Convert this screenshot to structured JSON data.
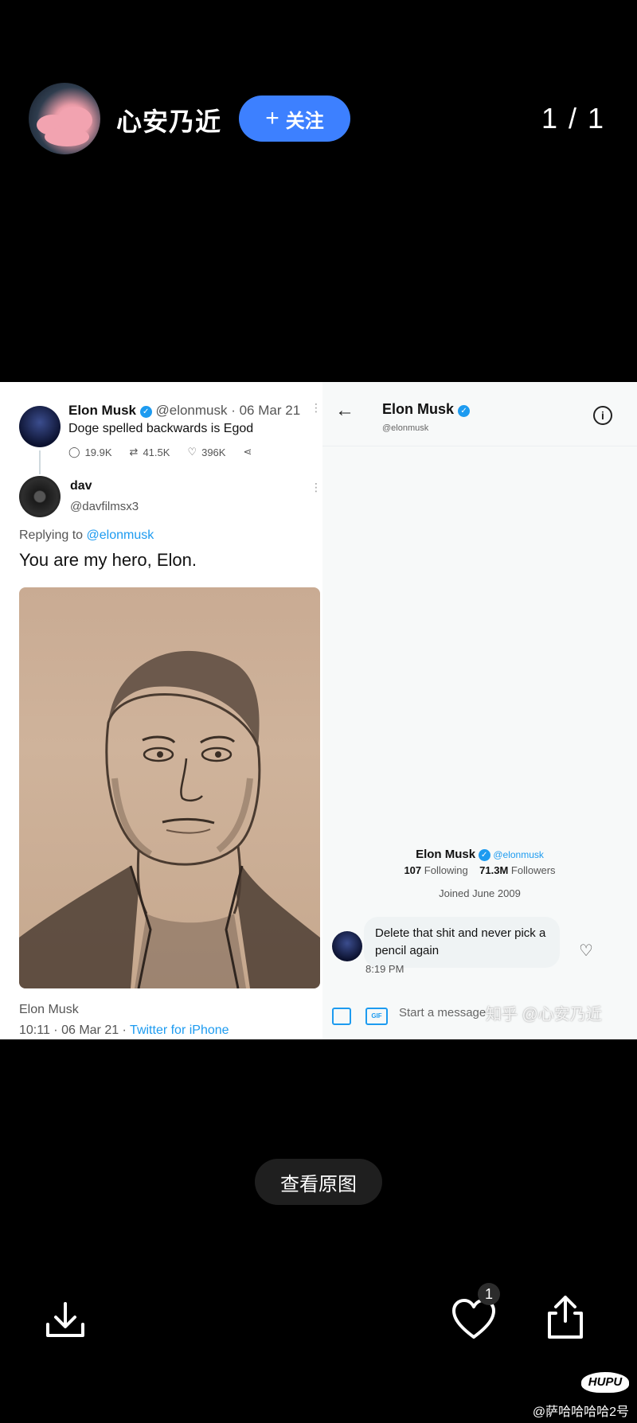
{
  "header": {
    "username": "心安乃近",
    "follow_label": "关注",
    "page_counter": "1 / 1"
  },
  "tweet": {
    "author_name": "Elon Musk",
    "handle_date": "@elonmusk · 06 Mar 21",
    "text": "Doge spelled backwards is Egod",
    "replies": "19.9K",
    "retweets": "41.5K",
    "likes": "396K"
  },
  "reply": {
    "name": "dav",
    "handle": "@davfilmsx3",
    "replying_prefix": "Replying to ",
    "replying_mention": "@elonmusk",
    "text": "You are my hero, Elon.",
    "footer_name": "Elon Musk",
    "footer_time": "10:11 · 06 Mar 21 · ",
    "footer_source": "Twitter for iPhone"
  },
  "dm": {
    "title": "Elon Musk",
    "handle": "@elonmusk",
    "profile_name": "Elon Musk",
    "profile_handle": "@elonmusk",
    "following_count": "107",
    "following_label": "Following",
    "followers_count": "71.3M",
    "followers_label": "Followers",
    "joined": "Joined June 2009",
    "message": "Delete that shit and never pick a pencil again",
    "time": "8:19 PM",
    "composer_placeholder": "Start a message",
    "gif_label": "GIF"
  },
  "watermark": "知乎 @心安乃近",
  "view_original_label": "查看原图",
  "bottom": {
    "like_count": "1",
    "hupu_logo": "HUPU",
    "hupu_user": "@萨哈哈哈哈2号"
  },
  "colors": {
    "follow_button": "#3d80ff",
    "twitter_blue": "#1d9bf0"
  }
}
